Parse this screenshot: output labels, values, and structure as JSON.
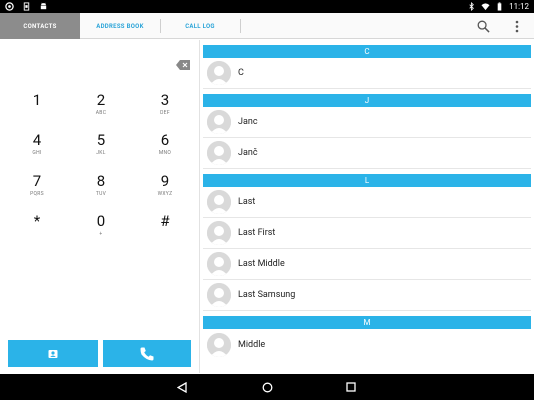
{
  "status_bar": {
    "time": "11:12"
  },
  "tabs": [
    {
      "label": "CONTACTS",
      "selected": true
    },
    {
      "label": "ADDRESS BOOK",
      "selected": false
    },
    {
      "label": "CALL LOG",
      "selected": false
    }
  ],
  "toolbar": {
    "search_icon": "search-icon",
    "overflow_icon": "more-vert-icon"
  },
  "dialpad": {
    "keys": [
      {
        "digit": "1",
        "letters": ""
      },
      {
        "digit": "2",
        "letters": "ABC"
      },
      {
        "digit": "3",
        "letters": "DEF"
      },
      {
        "digit": "4",
        "letters": "GHI"
      },
      {
        "digit": "5",
        "letters": "JKL"
      },
      {
        "digit": "6",
        "letters": "MNO"
      },
      {
        "digit": "7",
        "letters": "PQRS"
      },
      {
        "digit": "8",
        "letters": "TUV"
      },
      {
        "digit": "9",
        "letters": "WXYZ"
      },
      {
        "digit": "*",
        "letters": ""
      },
      {
        "digit": "0",
        "letters": "+"
      },
      {
        "digit": "#",
        "letters": ""
      }
    ]
  },
  "contacts": {
    "sections": [
      {
        "letter": "C",
        "names": [
          "C"
        ]
      },
      {
        "letter": "J",
        "names": [
          "Janc",
          "Janč"
        ]
      },
      {
        "letter": "L",
        "names": [
          "Last",
          "Last First",
          "Last Middle",
          "Last Samsung"
        ]
      },
      {
        "letter": "M",
        "names": [
          "Middle"
        ]
      }
    ]
  },
  "colors": {
    "accent": "#2bb3e8",
    "tab_text": "#2ba4d8",
    "selected_tab_bg": "#8c8c8c"
  }
}
